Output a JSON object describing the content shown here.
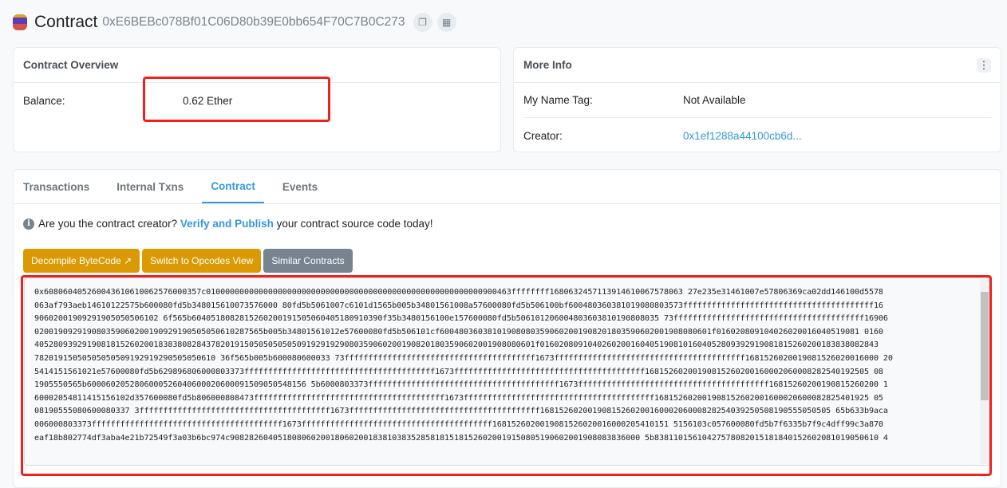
{
  "header": {
    "title": "Contract",
    "address": "0xE6BEBc078Bf01C06D80b39E0bb654F70C7B0C273",
    "icons": [
      "copy-icon",
      "qr-code-icon"
    ]
  },
  "overview": {
    "title": "Contract Overview",
    "balance_label": "Balance:",
    "balance_value": "0.62 Ether"
  },
  "more_info": {
    "title": "More Info",
    "name_tag_label": "My Name Tag:",
    "name_tag_value": "Not Available",
    "creator_label": "Creator:",
    "creator_value": "0x1ef1288a44100cb6d..."
  },
  "tabs": [
    {
      "label": "Transactions"
    },
    {
      "label": "Internal Txns"
    },
    {
      "label": "Contract",
      "active": true
    },
    {
      "label": "Events"
    }
  ],
  "notice": {
    "prefix": "Are you the contract creator?",
    "link": "Verify and Publish",
    "suffix": "your contract source code today!"
  },
  "buttons": {
    "decompile": "Decompile ByteCode",
    "opcodes": "Switch to Opcodes View",
    "similar": "Similar Contracts"
  },
  "colors": {
    "accent": "#3498db",
    "warning": "#db9a04",
    "secondary": "#77838f",
    "highlight": "#f0201c"
  },
  "bytecode": [
    "0x608060405260043610610062576000357c0100000000000000000000000000000000000000000000000000000000900463ffffffff1680632457113914610067578063 27e235e31461007e57806369ca02dd146100d5578",
    "063af793aeb14610122575b600080fd5b348015610073576000 80fd5b5061007c6101d1565b005b34801561008a57600080fd5b506100bf600480360381019080803573ffffffffffffffffffffffffffffffffffffffff16",
    "90602001909291905050506102 6f565b6040518082815260200191505060405180910390f35b3480156100e157600080fd5b506101206004803603810190808035 73ffffffffffffffffffffffffffffffffffffffff16906",
    "020019092919080359060200190929190505050610287565b005b34801561012e57600080fd5b506101cf600480360381019080803590602001908201803590602001908080601f016020809104026020016040519081 0160",
    "405280939291908181526020018383808284378201915050505050509192919290803590602001908201803590602001908080601f01602080910402602001604051908101604052809392919081815260200183838082843",
    "78201915050505050509192919290505050610 36f565b005b600080600033 73ffffffffffffffffffffffffffffffffffffffff1673ffffffffffffffffffffffffffffffffffffffff1681526020019081526020016000 20",
    "5414151561021e57600080fd5b629896806000803373ffffffffffffffffffffffffffffffffffffffff1673ffffffffffffffffffffffffffffffffffffffff16815260200190815260200160002060008282540192505 08",
    "1905550565b6000602052806000526040600020600091509050548156 5b6000803373ffffffffffffffffffffffffffffffffffffffff1673ffffffffffffffffffffffffffffffffffffffff16815260200190815260200 1",
    "60002054811415156102d357600080fd5b806000808473ffffffffffffffffffffffffffffffffffffffff1673ffffffffffffffffffffffffffffffffffffffff168152602001908152602001600020600082825401925 05",
    "08190555080600080337 3ffffffffffffffffffffffffffffffffffffffff1673ffffffffffffffffffffffffffffffffffffffff1681526020019081526020016000206000828254039250508190555050505 65b633b9aca",
    "006000803373ffffffffffffffffffffffffffffffffffffffff1673ffffffffffffffffffffffffffffffffffffffff1681526020019081526020016000205410151 5156103c057600080fd5b7f6335b7f9c4dff99c3a870",
    "eaf18b802774df3aba4e21b72549f3a03b6bc974c90828260405180806020018060200183810383528581815181526020019150805190602001908083836000 5b83811015610427578082015181840152602081019050610 4"
  ]
}
